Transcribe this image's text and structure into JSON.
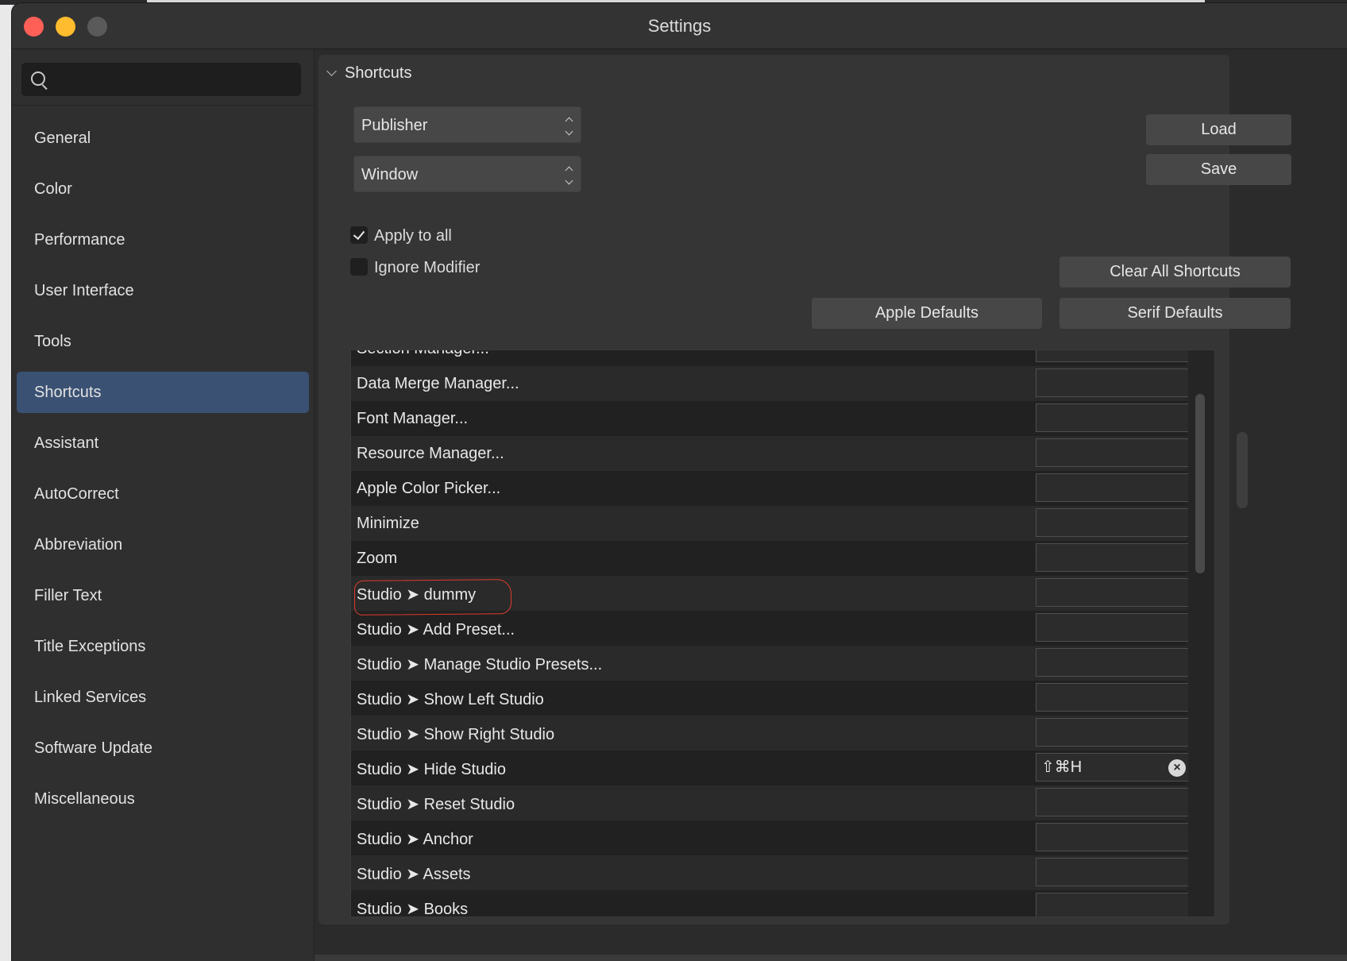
{
  "window": {
    "title": "Settings"
  },
  "sidebar": {
    "search_placeholder": "",
    "items": [
      {
        "label": "General"
      },
      {
        "label": "Color"
      },
      {
        "label": "Performance"
      },
      {
        "label": "User Interface"
      },
      {
        "label": "Tools"
      },
      {
        "label": "Shortcuts",
        "selected": true
      },
      {
        "label": "Assistant"
      },
      {
        "label": "AutoCorrect"
      },
      {
        "label": "Abbreviation"
      },
      {
        "label": "Filler Text"
      },
      {
        "label": "Title Exceptions"
      },
      {
        "label": "Linked Services"
      },
      {
        "label": "Software Update"
      },
      {
        "label": "Miscellaneous"
      }
    ]
  },
  "shortcuts": {
    "section_title": "Shortcuts",
    "app_select": "Publisher",
    "menu_select": "Window",
    "load_label": "Load",
    "save_label": "Save",
    "apply_to_all": {
      "label": "Apply to all",
      "checked": true
    },
    "ignore_modifier": {
      "label": "Ignore Modifier",
      "checked": false
    },
    "clear_all_label": "Clear All Shortcuts",
    "apple_defaults_label": "Apple Defaults",
    "serif_defaults_label": "Serif Defaults",
    "rows": [
      {
        "name": "Section Manager...",
        "shortcut": ""
      },
      {
        "name": "Data Merge Manager...",
        "shortcut": ""
      },
      {
        "name": "Font Manager...",
        "shortcut": ""
      },
      {
        "name": "Resource Manager...",
        "shortcut": ""
      },
      {
        "name": "Apple Color Picker...",
        "shortcut": ""
      },
      {
        "name": "Minimize",
        "shortcut": ""
      },
      {
        "name": "Zoom",
        "shortcut": ""
      },
      {
        "name": "Studio ➤ dummy",
        "shortcut": ""
      },
      {
        "name": "Studio ➤ Add Preset...",
        "shortcut": ""
      },
      {
        "name": "Studio ➤ Manage Studio Presets...",
        "shortcut": ""
      },
      {
        "name": "Studio ➤ Show Left Studio",
        "shortcut": ""
      },
      {
        "name": "Studio ➤ Show Right Studio",
        "shortcut": ""
      },
      {
        "name": "Studio ➤ Hide Studio",
        "shortcut": "⇧⌘H"
      },
      {
        "name": "Studio ➤ Reset Studio",
        "shortcut": ""
      },
      {
        "name": "Studio ➤ Anchor",
        "shortcut": ""
      },
      {
        "name": "Studio ➤ Assets",
        "shortcut": ""
      },
      {
        "name": "Studio ➤ Books",
        "shortcut": ""
      }
    ]
  }
}
